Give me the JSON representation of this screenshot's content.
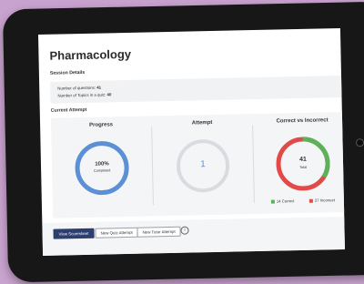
{
  "title": "Pharmacology",
  "session": {
    "heading": "Session Details",
    "questions_label": "Number of questions:",
    "questions_value": "41",
    "topics_label": "Number of Topics in a quiz:",
    "topics_value": "40"
  },
  "current": {
    "heading": "Current Attempt",
    "progress": {
      "title": "Progress",
      "value": "100%",
      "sub": "Completed",
      "fraction": 1.0,
      "color": "#5b8fd6"
    },
    "attempt": {
      "title": "Attempt",
      "value": "1",
      "color": "#d9dbe0"
    },
    "correct": {
      "title": "Correct vs Incorrect",
      "total": "41",
      "total_label": "Total",
      "correct_count": 14,
      "incorrect_count": 27,
      "correct_label": "14 Correct",
      "incorrect_label": "27 Incorrect",
      "correct_color": "#5ab35a",
      "incorrect_color": "#e24a4a"
    }
  },
  "buttons": {
    "scoresheet": "View Scoresheet",
    "quiz": "New Quiz Attempt",
    "tutor": "New Tutor Attempt",
    "info": "i"
  }
}
